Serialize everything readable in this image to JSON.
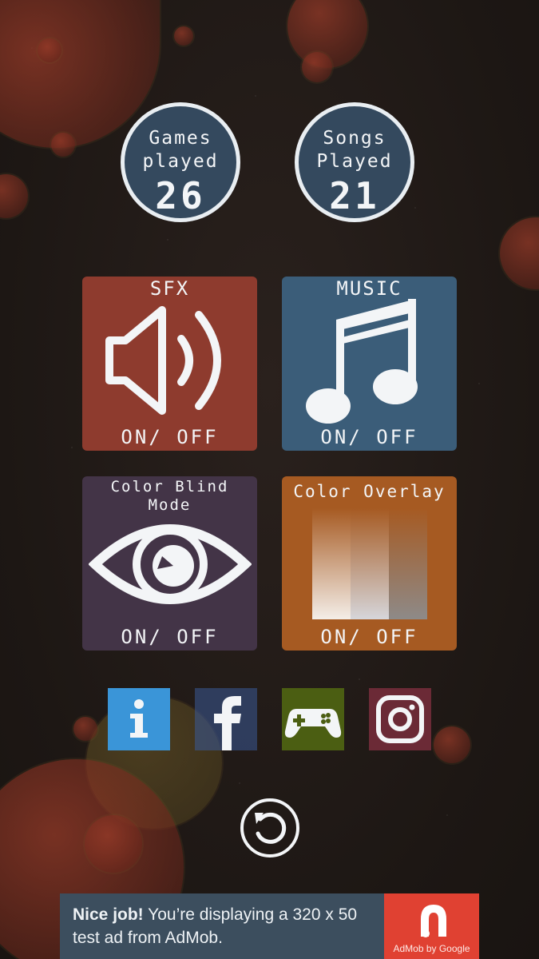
{
  "stats": {
    "games": {
      "label": "Games\nplayed",
      "value": "26"
    },
    "songs": {
      "label": "Songs\nPlayed",
      "value": "21"
    }
  },
  "toggles": {
    "sfx": {
      "title": "SFX",
      "state": "ON/ OFF",
      "color": "#8e3b2e",
      "icon": "speaker-icon"
    },
    "music": {
      "title": "MUSIC",
      "state": "ON/ OFF",
      "color": "#3b5d79",
      "icon": "music-note-icon"
    },
    "color_blind": {
      "title": "Color Blind\nMode",
      "state": "ON/ OFF",
      "color": "#433447",
      "icon": "eye-icon"
    },
    "color_overlay": {
      "title": "Color Overlay",
      "state": "ON/ OFF",
      "color": "#a65a22",
      "icon": "overlay-swatch-icon"
    }
  },
  "social": [
    {
      "icon": "info-icon",
      "color": "#3a95d8"
    },
    {
      "icon": "facebook-icon",
      "color": "#3b5998"
    },
    {
      "icon": "play-games-icon",
      "color": "#4b6a1e"
    },
    {
      "icon": "instagram-icon",
      "color": "#7a2a3a"
    }
  ],
  "refresh": {
    "icon": "refresh-icon"
  },
  "ad": {
    "bold": "Nice job!",
    "text": " You’re displaying a 320 x 50 test ad from AdMob.",
    "logo_caption": "AdMob by Google"
  }
}
